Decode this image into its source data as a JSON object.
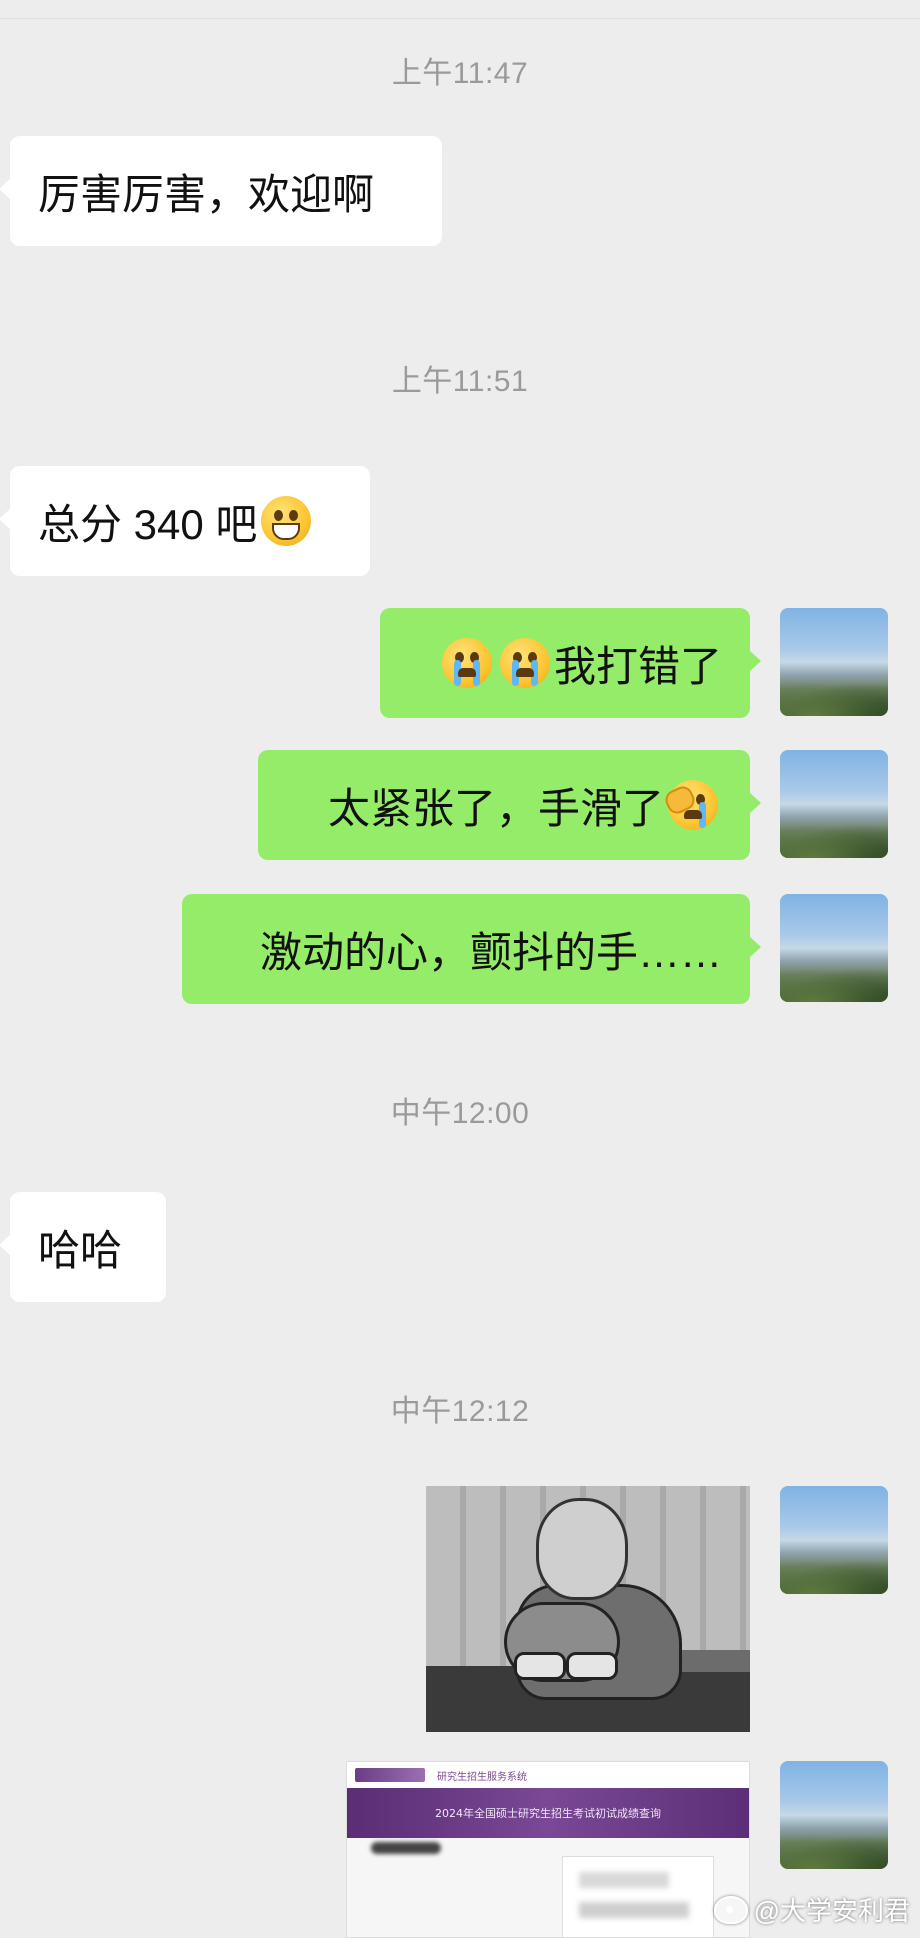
{
  "timestamps": [
    "上午11:47",
    "上午11:51",
    "中午12:00",
    "中午12:12"
  ],
  "messages": [
    {
      "side": "in",
      "text": "厉害厉害，欢迎啊"
    },
    {
      "side": "in",
      "text": "总分 340 吧",
      "emoji": "grinning-face"
    },
    {
      "side": "out",
      "text": "我打错了",
      "emoji_before": [
        "crying-face",
        "crying-face"
      ]
    },
    {
      "side": "out",
      "text": "太紧张了，手滑了",
      "emoji": "facepalm-face"
    },
    {
      "side": "out",
      "text": "激动的心，颤抖的手……"
    },
    {
      "side": "in",
      "text": "哈哈"
    },
    {
      "side": "out",
      "type": "image",
      "content": "sad-cartoon-meme"
    },
    {
      "side": "out",
      "type": "image",
      "content": "score-query-screenshot",
      "site_title": "研究生招生服务系统",
      "banner_text": "2024年全国硕士研究生招生考试初试成绩查询"
    }
  ],
  "colors": {
    "outgoing": "#95ec69",
    "incoming": "#ffffff",
    "background": "#ededed"
  },
  "watermark": "@大学安利君"
}
